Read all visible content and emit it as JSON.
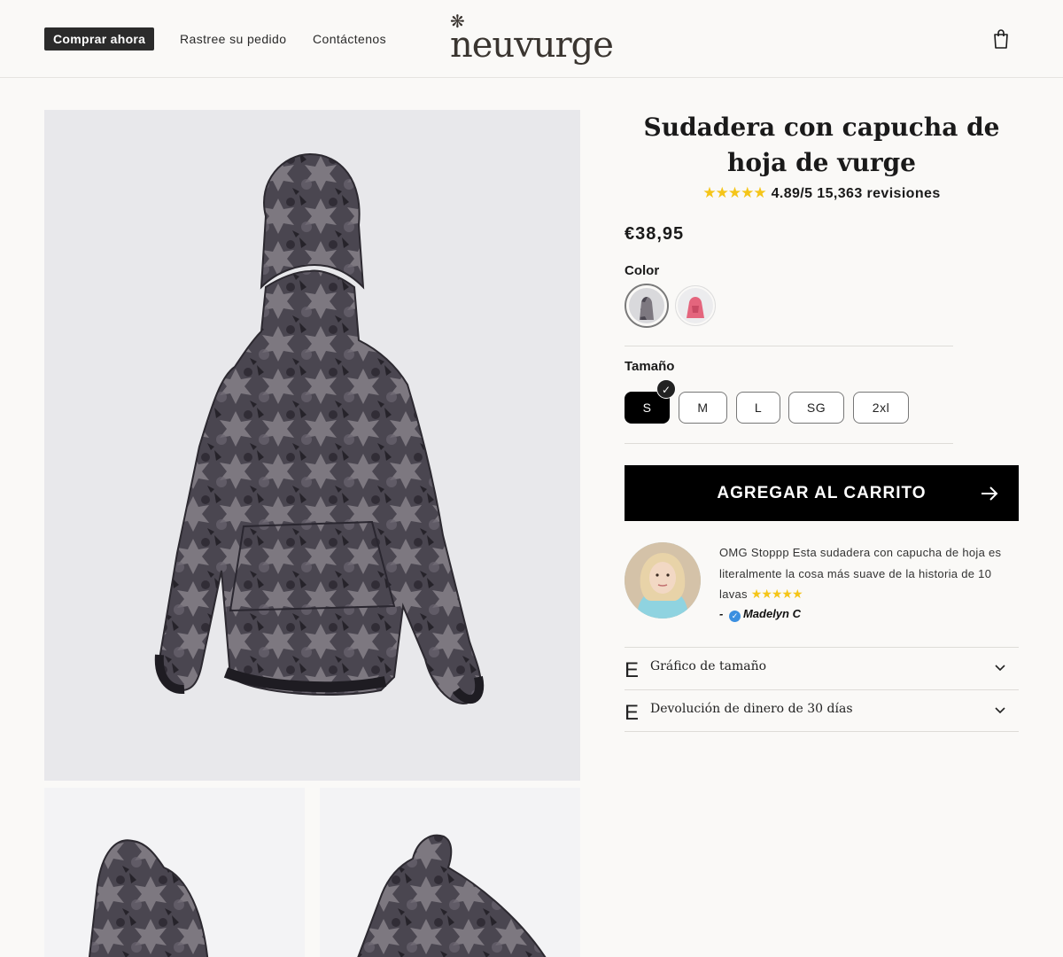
{
  "header": {
    "nav": [
      {
        "label": "Comprar ahora"
      },
      {
        "label": "Rastree su pedido"
      },
      {
        "label": "Contáctenos"
      }
    ],
    "logo_text": "neuvurge",
    "cart_icon": "shopping-bag-icon"
  },
  "product": {
    "title": "Sudadera con capucha de hoja de vurge",
    "rating_stars": "★★★★★",
    "rating_text": "4.89/5 15,363 revisiones",
    "price": "€38,95",
    "color_label": "Color",
    "size_label": "Tamaño",
    "sizes": [
      "S",
      "M",
      "L",
      "SG",
      "2xl"
    ],
    "selected_size": "S",
    "add_to_cart": "AGREGAR AL CARRITO"
  },
  "review": {
    "text": "OMG Stoppp Esta sudadera con capucha de hoja es literalmente la cosa más suave de la historia de 10 lavas",
    "stars": "★★★★★",
    "author": "Madelyn C",
    "dash": "-"
  },
  "accordions": [
    {
      "icon": "E",
      "label": "Gráfico de tamaño"
    },
    {
      "icon": "E",
      "label": "Devolución de dinero de 30 días"
    }
  ],
  "colors": {
    "accent": "#000000",
    "star": "#f5c518",
    "verified": "#3b8fe0"
  }
}
